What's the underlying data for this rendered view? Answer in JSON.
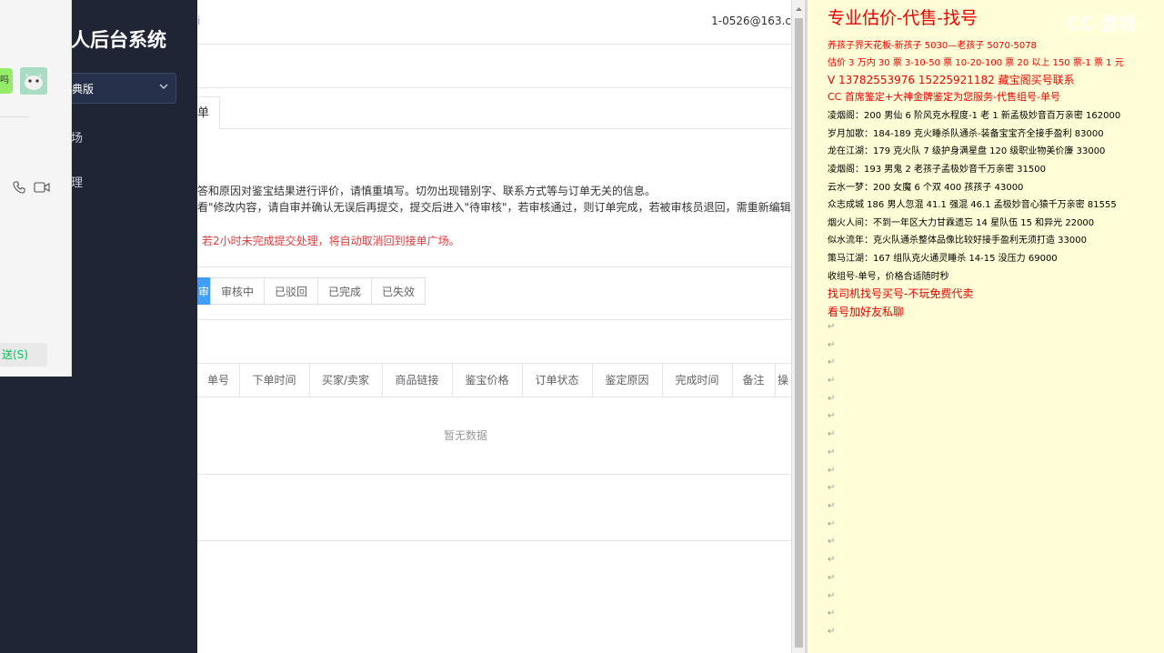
{
  "sidebar": {
    "title": "人后台系统",
    "version_label": "典版",
    "items": [
      {
        "label": "场"
      },
      {
        "label": "理"
      }
    ]
  },
  "chat": {
    "bubble_text": "吗",
    "send_label": "送(S)"
  },
  "topbar": {
    "left_text": "i",
    "user_email": "1-0526@163.c"
  },
  "tabs": [
    {
      "label": "单"
    }
  ],
  "notices": {
    "line1": "答和原因对鉴宝结果进行评价，请慎重填写。切勿出现错别字、联系方式等与订单无关的信息。",
    "line2": "看\"修改内容，请自审并确认无误后再提交，提交后进入\"待审核\"，若审核通过，则订单完成，若被审核员退回，需重新编辑",
    "line3": "若2小时未完成提交处理，将自动取消回到接单广场。"
  },
  "filters": [
    {
      "label": "审核中"
    },
    {
      "label": "已驳回"
    },
    {
      "label": "已完成"
    },
    {
      "label": "已失效"
    }
  ],
  "filter_active_label": "审",
  "table": {
    "columns": [
      "单号",
      "下单时间",
      "买家/卖家",
      "商品链接",
      "鉴宝价格",
      "订单状态",
      "鉴定原因",
      "完成时间",
      "备注",
      "操"
    ],
    "empty_text": "暂无数据"
  },
  "doc": {
    "heading": "专业估价-代售-找号",
    "lines": [
      {
        "text": "养孩子界天花板-新孩子 5030—老孩子 5070-5078",
        "red": true
      },
      {
        "text": "估价 3 万内 30 票  3-10-50 票  10-20-100 票  20 以上 150 票-1 票 1 元",
        "red": true
      },
      {
        "text": "V 13782553976   15225921182  藏宝阁买号联系",
        "red": true
      },
      {
        "text": "CC 首席鉴定+大神金牌鉴定为您服务-代售组号-单号",
        "red": true
      },
      {
        "text": "凌烟阁：200 男仙 6 阶风克水程度-1 老 1 新孟极妙音百万亲密 162000",
        "red": false
      },
      {
        "text": "岁月加歌：184-189 克火睡杀队通杀-装备宝宝齐全接手盈利 83000",
        "red": false
      },
      {
        "text": "龙在江湖：179 克火队 7 级护身满星盘 120 级职业物美价廉 33000",
        "red": false
      },
      {
        "text": "凌烟阁：193 男鬼 2 老孩子孟极妙音千万亲密 31500",
        "red": false
      },
      {
        "text": "云水一梦：200 女魔 6 个双 400 孩孩子 43000",
        "red": false
      },
      {
        "text": "众志成城 186 男人忽混 41.1 强混 46.1 孟极妙音心猿千万亲密 81555",
        "red": false
      },
      {
        "text": "烟火人间：不到一年区大力甘霖遗忘 14 星队伍 15 和异光 22000",
        "red": false
      },
      {
        "text": "似水流年：克火队通杀整体品像比较好接手盈利无须打造 33000",
        "red": false
      },
      {
        "text": "策马江湖：167 组队克火通灵睡杀 14-15 没压力 69000",
        "red": false
      },
      {
        "text": "收组号-单号，价格合适随时秒",
        "red": false
      },
      {
        "text": "找司机找号买号-不玩免费代卖",
        "red": true
      },
      {
        "text": "看号加好友私聊",
        "red": true
      }
    ],
    "watermark": "CC 游戏"
  }
}
